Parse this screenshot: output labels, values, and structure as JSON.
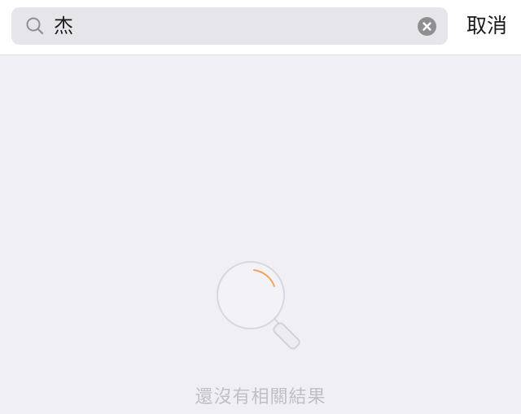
{
  "search": {
    "value": "杰",
    "placeholder": ""
  },
  "actions": {
    "cancel_label": "取消"
  },
  "empty_state": {
    "message": "還沒有相關結果"
  },
  "icons": {
    "search": "search-icon",
    "clear": "clear-icon",
    "empty": "magnifier-icon"
  },
  "colors": {
    "background": "#f0eff5",
    "field": "#e6e6ea",
    "accent": "#f2a25a"
  }
}
